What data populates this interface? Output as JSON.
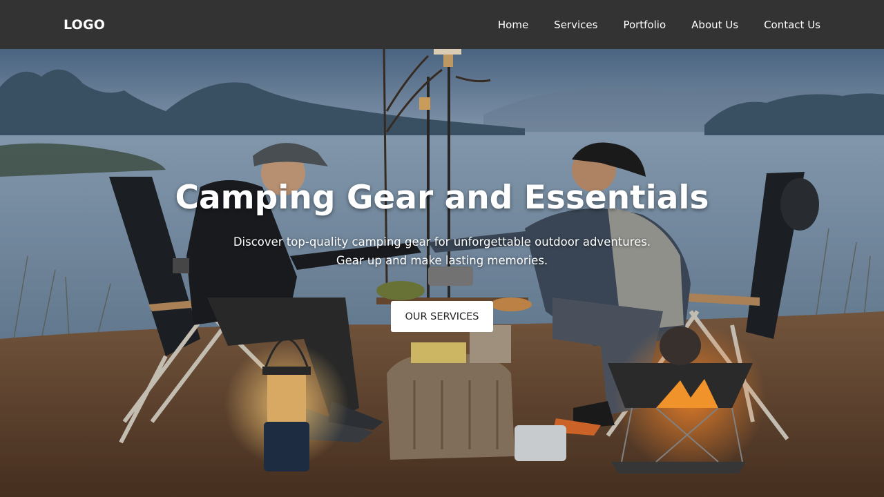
{
  "navbar": {
    "logo": "LOGO",
    "links": [
      {
        "label": "Home"
      },
      {
        "label": "Services"
      },
      {
        "label": "Portfolio"
      },
      {
        "label": "About Us"
      },
      {
        "label": "Contact Us"
      }
    ]
  },
  "hero": {
    "title": "Camping Gear and Essentials",
    "subtitle_line1": "Discover top-quality camping gear for unforgettable outdoor adventures.",
    "subtitle_line2": "Gear up and make lasting memories.",
    "cta_label": "OUR SERVICES"
  },
  "colors": {
    "navbar_bg": "#333333",
    "text_light": "#ffffff",
    "button_bg": "#ffffff",
    "button_text": "#222222"
  }
}
